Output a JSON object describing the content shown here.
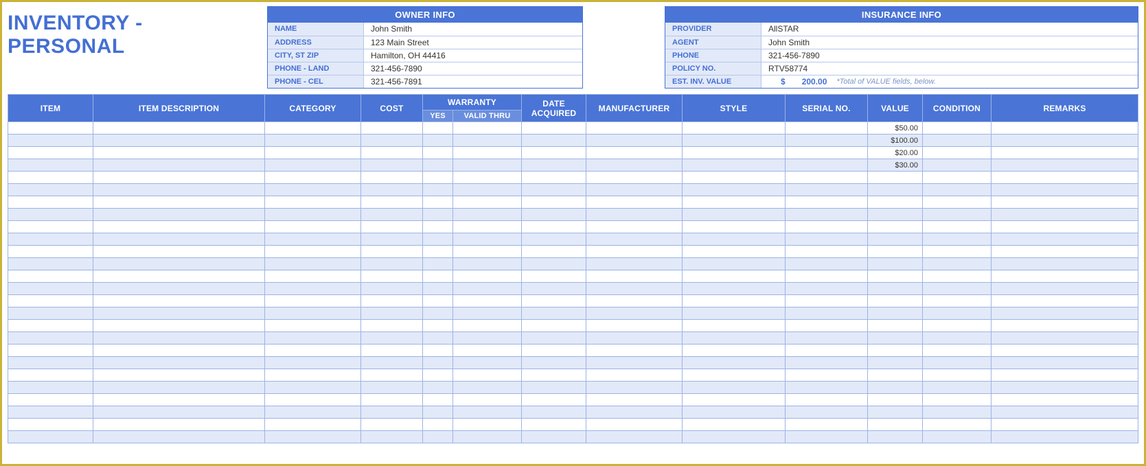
{
  "title": "INVENTORY - PERSONAL",
  "owner": {
    "header": "OWNER INFO",
    "rows": [
      {
        "label": "NAME",
        "value": "John Smith"
      },
      {
        "label": "ADDRESS",
        "value": "123 Main Street"
      },
      {
        "label": "CITY, ST  ZIP",
        "value": "Hamilton, OH  44416"
      },
      {
        "label": "PHONE - LAND",
        "value": "321-456-7890"
      },
      {
        "label": "PHONE - CEL",
        "value": "321-456-7891"
      }
    ]
  },
  "insurance": {
    "header": "INSURANCE INFO",
    "rows": [
      {
        "label": "PROVIDER",
        "value": "AllSTAR"
      },
      {
        "label": "AGENT",
        "value": "John Smith"
      },
      {
        "label": "PHONE",
        "value": "321-456-7890"
      },
      {
        "label": "POLICY NO.",
        "value": "RTV58774"
      }
    ],
    "est_label": "EST. INV. VALUE",
    "est_dollar": "$",
    "est_amount": "200.00",
    "est_note": "*Total of VALUE fields, below."
  },
  "headers": {
    "item": "ITEM",
    "desc": "ITEM DESCRIPTION",
    "cat": "CATEGORY",
    "cost": "COST",
    "warranty": "WARRANTY",
    "w_yes": "YES",
    "w_valid": "VALID THRU",
    "date": "DATE ACQUIRED",
    "manu": "MANUFACTURER",
    "style": "STYLE",
    "serial": "SERIAL NO.",
    "value": "VALUE",
    "cond": "CONDITION",
    "rem": "REMARKS"
  },
  "rows": [
    {
      "value": "$50.00"
    },
    {
      "value": "$100.00"
    },
    {
      "value": "$20.00"
    },
    {
      "value": "$30.00"
    },
    {},
    {},
    {},
    {},
    {},
    {},
    {},
    {},
    {},
    {},
    {},
    {},
    {},
    {},
    {},
    {},
    {},
    {},
    {},
    {},
    {},
    {}
  ]
}
